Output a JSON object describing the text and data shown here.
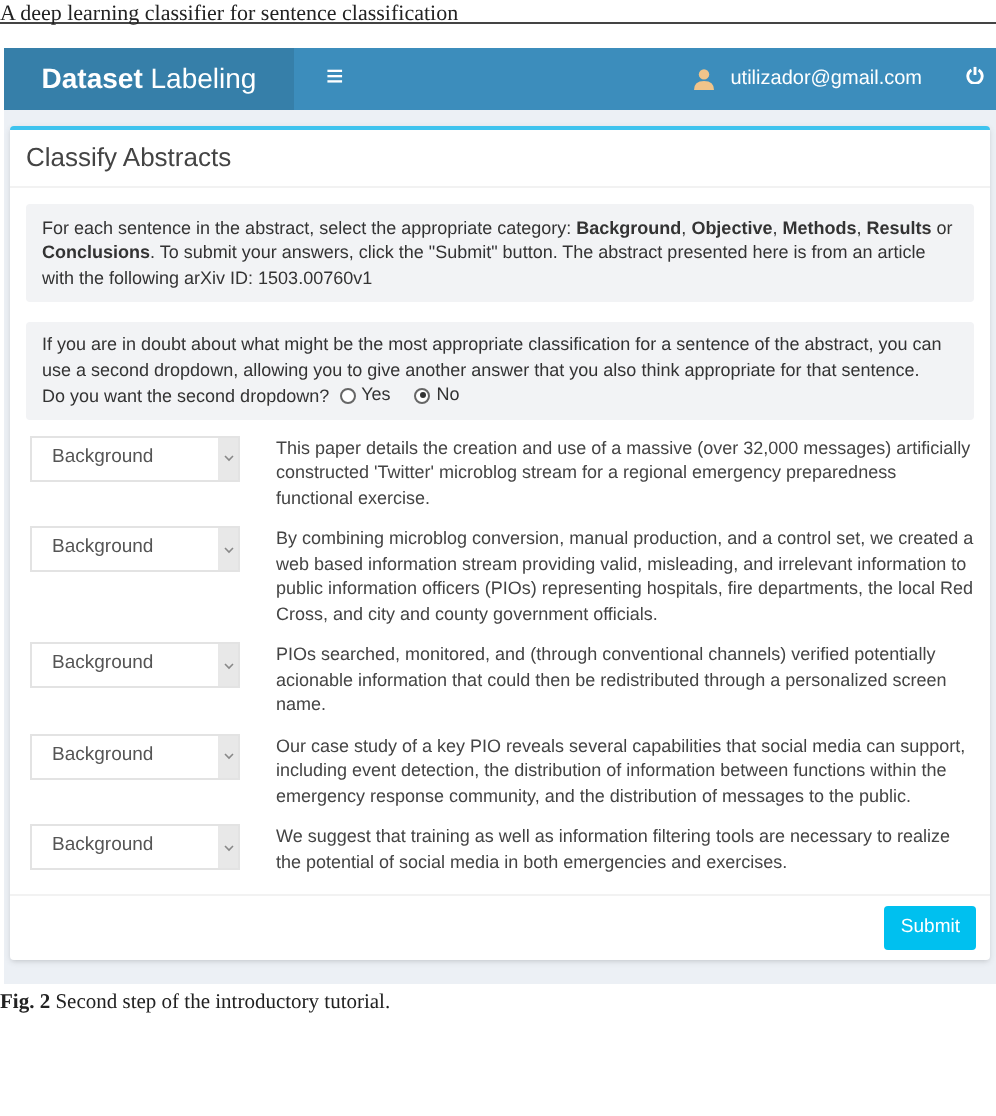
{
  "running_header": "A deep learning classifier for sentence classification",
  "navbar": {
    "brand_bold": "Dataset",
    "brand_rest": "Labeling",
    "menu_glyph": "≡",
    "user": "utilizador@gmail.com"
  },
  "box": {
    "title": "Classify Abstracts",
    "instructions": "For each sentence in the abstract, select the appropriate category: **Background**, **Objective**, **Methods**, **Results** or **Conclusions**. To submit your answers, click the \"Submit\" button. The abstract presented here is from an article with the following arXiv ID: 1503.00760v1",
    "question": "If you are in doubt about what might be the most appropriate classification for a sentence of the abstract, you can use a second dropdown, allowing you to give another answer that you also think appropriate for that sentence.",
    "prompt": "Do you want the second dropdown?",
    "options": [
      {
        "label": "Yes",
        "selected": false
      },
      {
        "label": "No",
        "selected": true
      }
    ],
    "sentences": [
      {
        "category": "Background",
        "text": "This paper details the creation and use of a massive (over 32,000 messages) artificially constructed 'Twitter' microblog stream for a regional emergency preparedness functional exercise."
      },
      {
        "category": "Background",
        "text": "By combining microblog conversion, manual production, and a control set, we created a web based information stream providing valid, misleading, and irrelevant information to public information officers (PIOs) representing hospitals, fire departments, the local Red Cross, and city and county government officials."
      },
      {
        "category": "Background",
        "text": "PIOs searched, monitored, and (through conventional channels) verified potentially acionable information that could then be redistributed through a personalized screen name."
      },
      {
        "category": "Background",
        "text": "Our case study of a key PIO reveals several capabilities that social media can support, including event detection, the distribution of information between functions within the emergency response community, and the distribution of messages to the public."
      },
      {
        "category": "Background",
        "text": "We suggest that training as well as information filtering tools are necessary to realize the potential of social media in both emergencies and exercises."
      }
    ],
    "submit": "Submit"
  },
  "caption": {
    "label": "Fig. 2",
    "text": "Second step of the introductory tutorial."
  }
}
